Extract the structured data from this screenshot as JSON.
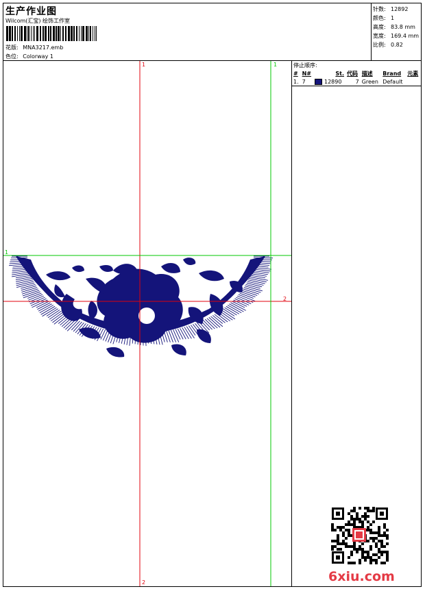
{
  "header": {
    "title": "生产作业图",
    "subtitle": "Wilcom(汇宝) 绘饰工作室",
    "design_label": "花版:",
    "design_value": "MNA3217.emb",
    "colorway_label": "色位:",
    "colorway_value": "Colorway 1"
  },
  "stats": [
    {
      "label": "针数:",
      "value": "12892"
    },
    {
      "label": "颜色:",
      "value": "1"
    },
    {
      "label": "高度:",
      "value": "83.8 mm"
    },
    {
      "label": "宽度:",
      "value": "169.4 mm"
    },
    {
      "label": "比例:",
      "value": "0.82"
    }
  ],
  "stop_sequence": {
    "title": "停止顺序:",
    "columns": [
      "#",
      "N#",
      "St.",
      "代码",
      "描述",
      "Brand",
      "元素"
    ],
    "rows": [
      {
        "index": "1.",
        "needle": "7",
        "stitches": "12890",
        "code": "7",
        "description": "Green",
        "brand": "Default",
        "element": ""
      }
    ],
    "thread_color": "#14147a"
  },
  "guides": {
    "v_red_top": "1",
    "v_red_bottom": "2",
    "h_green": "1",
    "h_red": "2",
    "v_green_top": "1"
  },
  "colors": {
    "embroidery": "#14147a",
    "guide_red": "#e0000b",
    "guide_green": "#00c800",
    "watermark": "#e43a45"
  },
  "watermark": "6xiu.com"
}
